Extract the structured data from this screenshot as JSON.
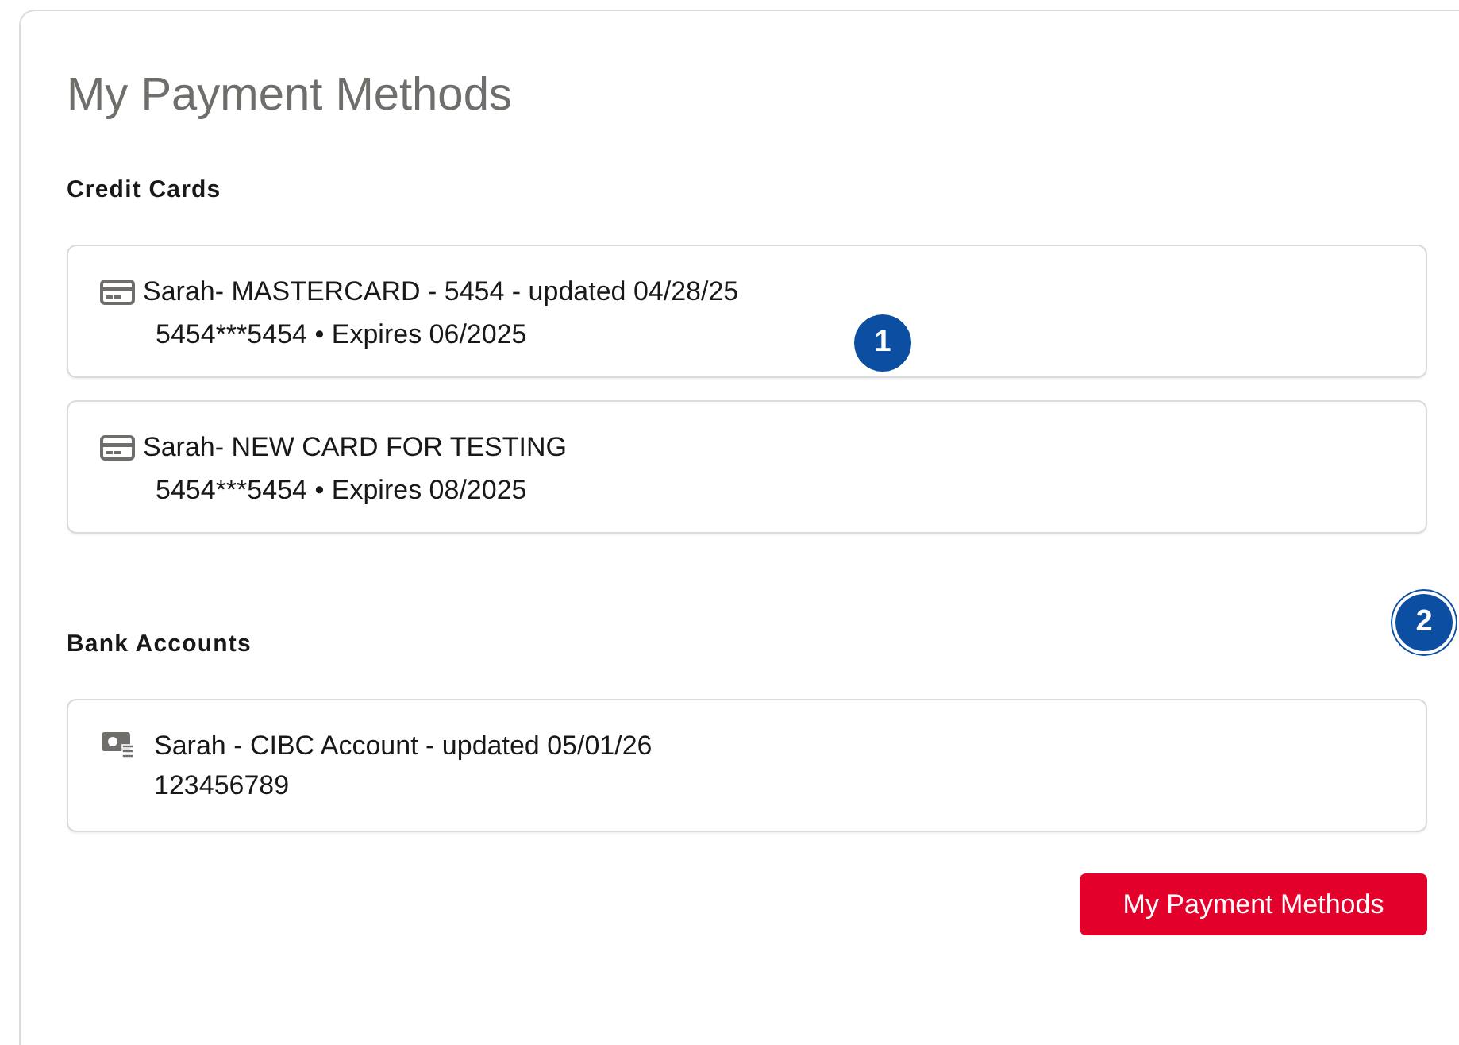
{
  "title": "My Payment Methods",
  "sections": [
    {
      "heading": "Credit Cards",
      "items": [
        {
          "kind": "card",
          "name": "Sarah",
          "description": "- MASTERCARD - 5454 - updated 04/28/25",
          "detail": "5454***5454 • Expires 06/2025"
        },
        {
          "kind": "card",
          "name": "Sarah",
          "description": "- NEW CARD FOR TESTING",
          "detail": "5454***5454 • Expires 08/2025"
        }
      ]
    },
    {
      "heading": "Bank Accounts",
      "items": [
        {
          "kind": "bank",
          "name": "Sarah",
          "description": "- CIBC Account - updated 05/01/26",
          "detail": "123456789"
        }
      ]
    }
  ],
  "button": "My Payment Methods",
  "markers": [
    {
      "label": "1"
    },
    {
      "label": "2"
    }
  ]
}
